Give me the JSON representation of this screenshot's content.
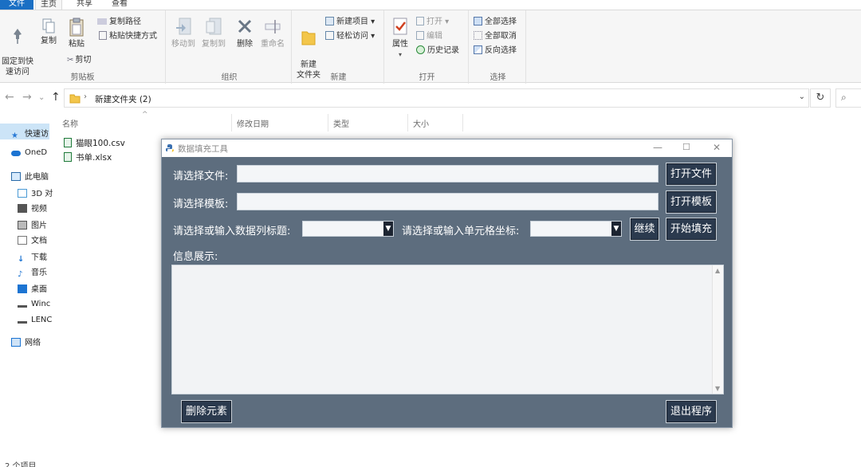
{
  "ribbon_tabs": {
    "file": "文件",
    "home": "主页",
    "share": "共享",
    "view": "查看"
  },
  "clipboard": {
    "pin": "固定到快\n速访问",
    "copy": "复制",
    "paste": "粘贴",
    "copy_path": "复制路径",
    "paste_shortcut": "粘贴快捷方式",
    "cut": "剪切",
    "label": "剪贴板"
  },
  "organize": {
    "move_to": "移动到",
    "copy_to": "复制到",
    "delete": "删除",
    "rename": "重命名",
    "label": "组织"
  },
  "new_group": {
    "new_item": "新建项目",
    "easy_access": "轻松访问",
    "new_folder": "新建\n文件夹",
    "label": "新建"
  },
  "open_group": {
    "properties": "属性",
    "open": "打开",
    "edit": "编辑",
    "history": "历史记录",
    "label": "打开"
  },
  "select_group": {
    "select_all": "全部选择",
    "select_none": "全部取消",
    "invert": "反向选择",
    "label": "选择"
  },
  "address": {
    "path": "新建文件夹 (2)"
  },
  "nav_pane": [
    "快速访",
    "OneD",
    "此电脑",
    "3D 对",
    "视频",
    "图片",
    "文档",
    "下载",
    "音乐",
    "桌面",
    "Winc",
    "LENC",
    "网络"
  ],
  "columns": {
    "name": "名称",
    "modified": "修改日期",
    "type": "类型",
    "size": "大小"
  },
  "files": [
    "猫眼100.csv",
    "书单.xlsx"
  ],
  "status": "2 个项目",
  "dialog": {
    "title": "数据填充工具",
    "file_label": "请选择文件:",
    "template_label": "请选择模板:",
    "column_label": "请选择或输入数据列标题:",
    "cell_label": "请选择或输入单元格坐标:",
    "info_label": "信息展示:",
    "open_file": "打开文件",
    "open_template": "打开模板",
    "continue": "继续",
    "start_fill": "开始填充",
    "delete_element": "删除元素",
    "exit": "退出程序"
  },
  "colors": {
    "dialog_bg": "#5d6d7e",
    "button_bg": "#2b3a4e",
    "accent": "#1a6fc4"
  }
}
